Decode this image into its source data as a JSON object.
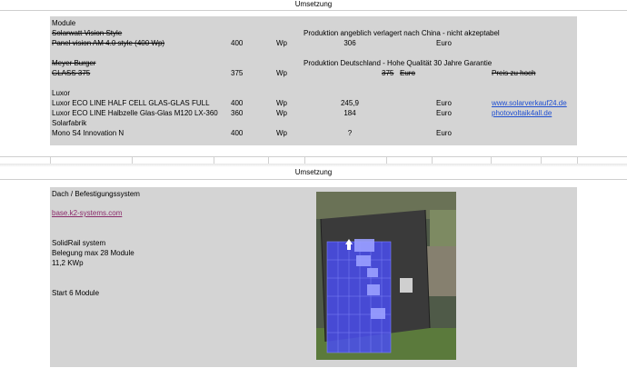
{
  "sheet1": {
    "title": "Umsetzung",
    "section_label": "Module",
    "rows": [
      {
        "name": "Solarwatt Vision Style",
        "strike": true,
        "note": "Produktion angeblich verlagert nach China - nicht akzeptabel"
      },
      {
        "name": "Panel vision AM 4.0 style (400 Wp)",
        "strike": true,
        "power": "400",
        "unit": "Wp",
        "price": "306",
        "currency": "Euro"
      },
      {
        "name": "Meyer Burger",
        "strike": true,
        "note": "Produktion Deutschland - Hohe Qualität 30 Jahre Garantie"
      },
      {
        "name": "GLASS 375",
        "strike": true,
        "power": "375",
        "unit": "Wp",
        "price": "375",
        "currency": "Euro",
        "remark": "Preis zu hoch"
      },
      {
        "name": "Luxor"
      },
      {
        "name": "Luxor ECO LINE HALF CELL GLAS-GLAS FULL",
        "power": "400",
        "unit": "Wp",
        "price": "245,9",
        "currency": "Euro",
        "link": "www.solarverkauf24.de"
      },
      {
        "name": "Luxor ECO LINE Halbzelle Glas-Glas M120 LX-360",
        "power": "360",
        "unit": "Wp",
        "price": "184",
        "currency": "Euro",
        "link": "photovoltaik4all.de"
      },
      {
        "name": "Solarfabrik"
      },
      {
        "name": "Mono S4 Innovation N",
        "power": "400",
        "unit": "Wp",
        "price": "?",
        "currency": "Euro"
      }
    ]
  },
  "sheet2": {
    "title": "Umsetzung",
    "heading": "Dach / Befestigungssystem",
    "link": "base.k2-systems.com",
    "system_lines": [
      "SolidRail system",
      "Belegung max 28 Module",
      "11,2 KWp"
    ],
    "start": "Start 6 Module"
  },
  "image": {
    "icon": "roof-layout-satellite-image",
    "panel_color": "#4a4ef0",
    "roof_color": "#3a3a3a",
    "grass_color": "#5b7a3c"
  }
}
